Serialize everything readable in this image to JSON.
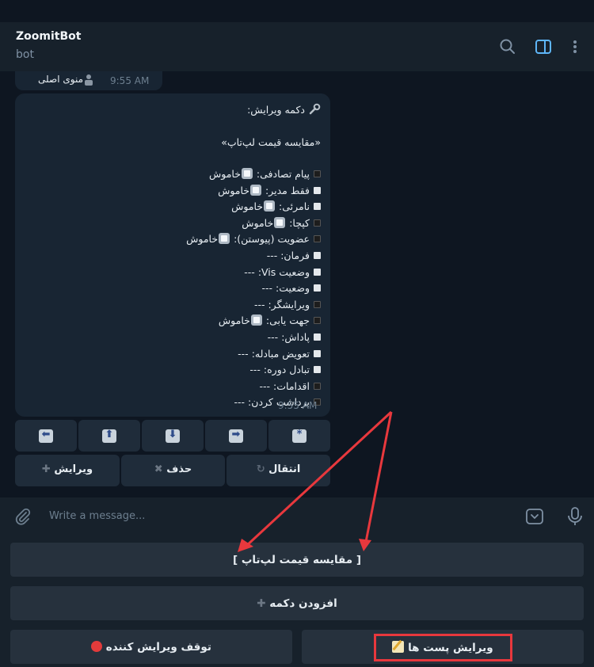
{
  "header": {
    "title": "ZoomitBot",
    "subtitle": "bot",
    "icons": [
      "search-icon",
      "sidebar-toggle-icon",
      "more-vertical-icon"
    ]
  },
  "prev_message": {
    "text": "منوی اصلی",
    "time": "9:55 AM"
  },
  "message": {
    "edit_title": "دکمه ویرایش:",
    "button_name": "«مقایسه قیمت لپ‌تاپ»",
    "state_off": "خاموش",
    "lines": [
      {
        "label": "پیام تصادفی:",
        "value": "",
        "toggle": true,
        "bullet": "black"
      },
      {
        "label": "فقط مدیر:",
        "value": "",
        "toggle": true,
        "bullet": "white"
      },
      {
        "label": "نامرئی:",
        "value": "",
        "toggle": true,
        "bullet": "white"
      },
      {
        "label": "کپچا:",
        "value": "",
        "toggle": true,
        "bullet": "black"
      },
      {
        "label": "عضویت (پیوستن):",
        "value": "",
        "toggle": true,
        "bullet": "black"
      },
      {
        "label": "فرمان:",
        "value": "---",
        "toggle": false,
        "bullet": "white"
      },
      {
        "label": "وضعیت Vis:",
        "value": "---",
        "toggle": false,
        "bullet": "white"
      },
      {
        "label": "وضعیت:",
        "value": "---",
        "toggle": false,
        "bullet": "white"
      },
      {
        "label": "ویرایشگر:",
        "value": "---",
        "toggle": false,
        "bullet": "black"
      },
      {
        "label": "جهت یابی:",
        "value": "",
        "toggle": true,
        "bullet": "black"
      },
      {
        "label": "پاداش:",
        "value": "---",
        "toggle": false,
        "bullet": "white"
      },
      {
        "label": "تعویض مبادله:",
        "value": "---",
        "toggle": false,
        "bullet": "white"
      },
      {
        "label": "تبادل دوره:",
        "value": "---",
        "toggle": false,
        "bullet": "white"
      },
      {
        "label": "اقدامات:",
        "value": "---",
        "toggle": false,
        "bullet": "black"
      },
      {
        "label": "برداشت کردن:",
        "value": "---",
        "toggle": false,
        "bullet": "black"
      }
    ],
    "time": "9:55 AM"
  },
  "inline_keyboard": {
    "arrows": [
      "⬅",
      "⬆",
      "⬇",
      "➡",
      "*"
    ],
    "move": "انتقال",
    "delete": "حذف",
    "edit": "ویرایش"
  },
  "composer": {
    "placeholder": "Write a message..."
  },
  "reply_keyboard": {
    "compare": "[ مقایسه قیمت لپ‌تاپ ]",
    "add_button": "افزودن دکمه",
    "stop_editor": "توقف ویرایش کننده",
    "edit_posts": "ویرایش پست ها"
  },
  "colors": {
    "annotation_red": "#e8383d",
    "background": "#0e1621",
    "panel": "#17212b",
    "bubble": "#182533"
  }
}
